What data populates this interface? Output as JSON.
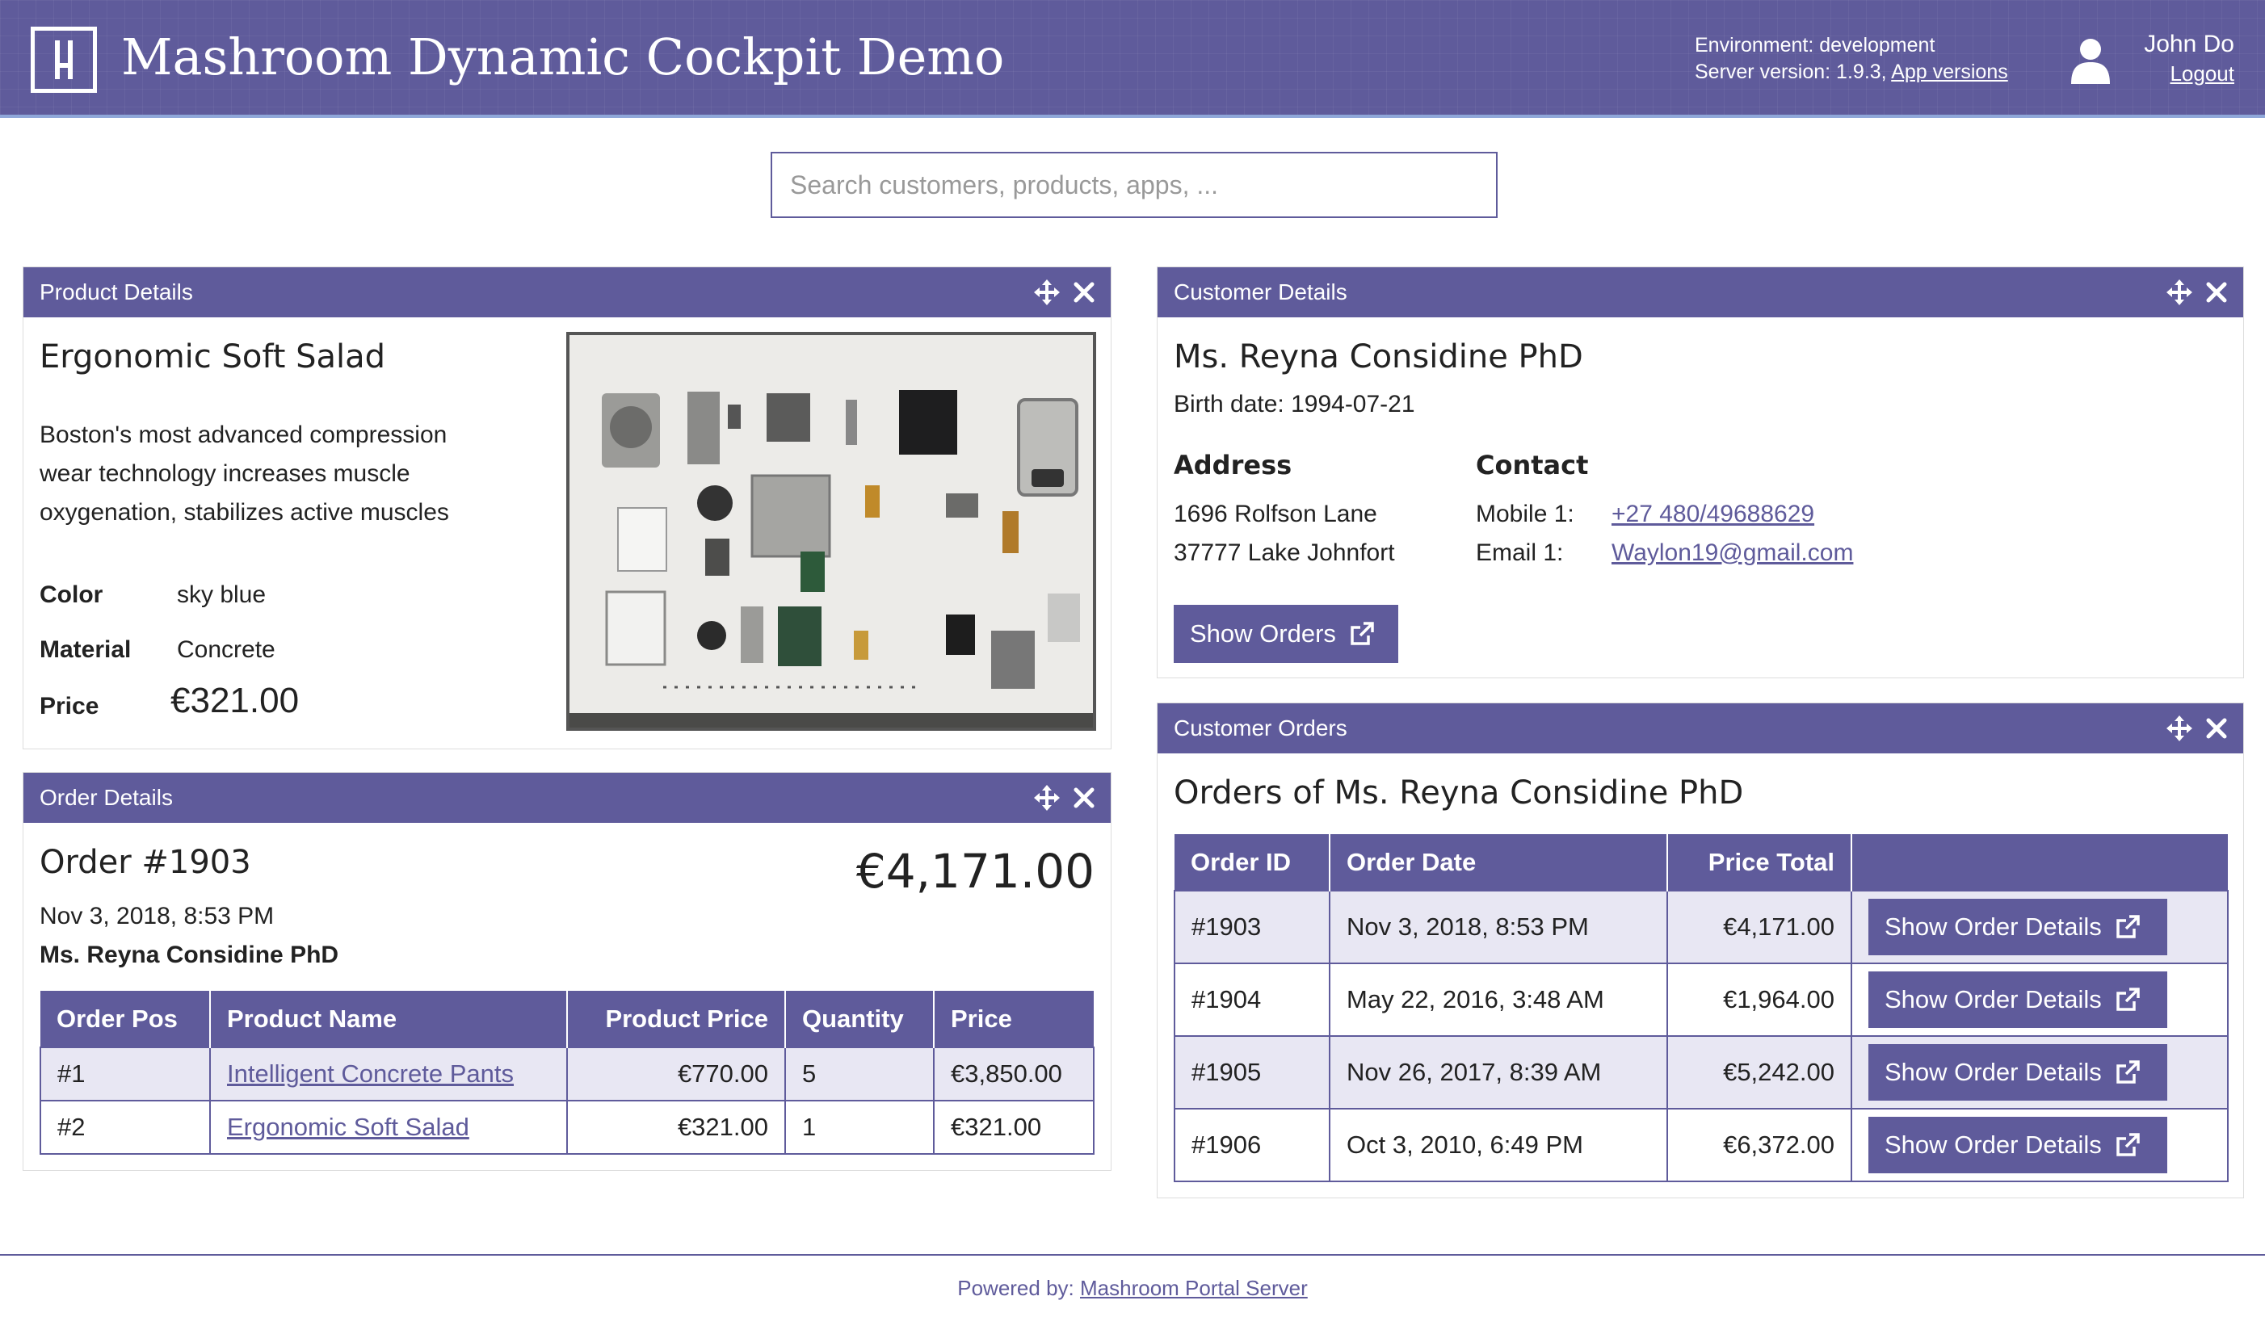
{
  "header": {
    "title": "Mashroom Dynamic Cockpit Demo",
    "environment": "Environment: development",
    "server_version": "Server version: 1.9.3,",
    "app_versions": "App versions",
    "user_name": "John Do",
    "logout": "Logout"
  },
  "search": {
    "placeholder": "Search customers, products, apps, ..."
  },
  "product": {
    "panel_title": "Product Details",
    "name": "Ergonomic Soft Salad",
    "description_lines": [
      "Boston's most advanced compression",
      "wear technology increases muscle",
      "oxygenation, stabilizes active muscles"
    ],
    "color_label": "Color",
    "color_value": "sky blue",
    "material_label": "Material",
    "material_value": "Concrete",
    "price_label": "Price",
    "price_value": "€321.00",
    "image": "camera-parts-flatlay-image"
  },
  "order": {
    "panel_title": "Order Details",
    "order_no": "Order #1903",
    "total": "€4,171.00",
    "date": "Nov 3, 2018, 8:53 PM",
    "customer": "Ms. Reyna Considine PhD",
    "columns": [
      "Order Pos",
      "Product Name",
      "Product Price",
      "Quantity",
      "Price"
    ],
    "rows": [
      {
        "pos": "#1",
        "product": "Intelligent Concrete Pants",
        "product_price": "€770.00",
        "qty": "5",
        "price": "€3,850.00"
      },
      {
        "pos": "#2",
        "product": "Ergonomic Soft Salad",
        "product_price": "€321.00",
        "qty": "1",
        "price": "€321.00"
      }
    ]
  },
  "customer": {
    "panel_title": "Customer Details",
    "name": "Ms. Reyna Considine PhD",
    "birth": "Birth date: 1994-07-21",
    "address_title": "Address",
    "address_lines": [
      "1696 Rolfson Lane",
      "37777 Lake Johnfort"
    ],
    "contact_title": "Contact",
    "mobile_label": "Mobile 1:",
    "mobile": "+27 480/49688629",
    "email_label": "Email 1:",
    "email": "Waylon19@gmail.com",
    "show_orders": "Show Orders"
  },
  "orders": {
    "panel_title": "Customer Orders",
    "heading": "Orders of Ms. Reyna Considine PhD",
    "columns": [
      "Order ID",
      "Order Date",
      "Price Total",
      ""
    ],
    "button_label": "Show Order Details",
    "rows": [
      {
        "id": "#1903",
        "date": "Nov 3, 2018, 8:53 PM",
        "total": "€4,171.00"
      },
      {
        "id": "#1904",
        "date": "May 22, 2016, 3:48 AM",
        "total": "€1,964.00"
      },
      {
        "id": "#1905",
        "date": "Nov 26, 2017, 8:39 AM",
        "total": "€5,242.00"
      },
      {
        "id": "#1906",
        "date": "Oct 3, 2010, 6:49 PM",
        "total": "€6,372.00"
      }
    ]
  },
  "footer": {
    "prefix": "Powered by:",
    "link": "Mashroom Portal Server"
  },
  "colors": {
    "brand": "#5f5b9b",
    "row_alt": "#e8e7f3",
    "header_accent": "#8fa7d9"
  }
}
